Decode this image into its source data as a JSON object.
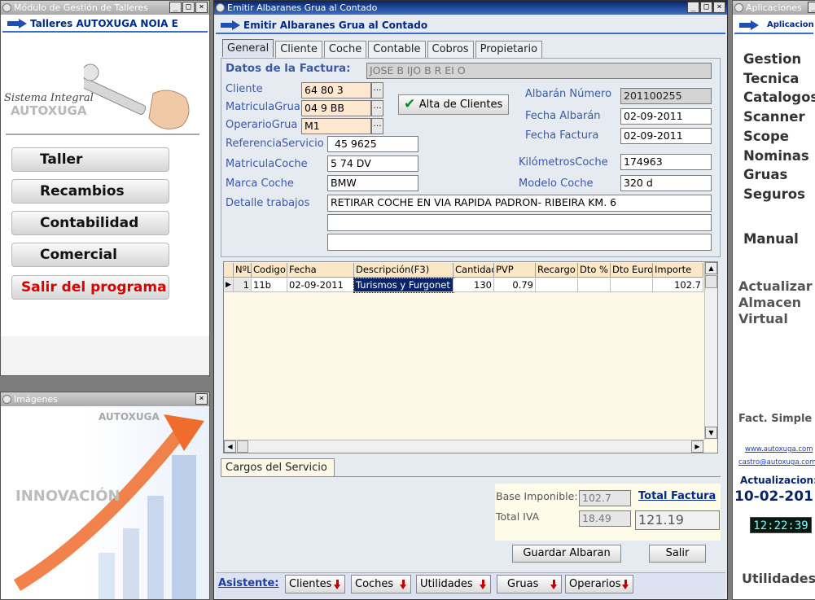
{
  "left_window": {
    "title": "Módulo de Gestión de Talleres",
    "header": "Talleres AUTOXUGA NOIA E",
    "logo_text": "Sistema Integral",
    "logo_brand": "AUTOXUGA",
    "menu": [
      "Taller",
      "Recambios",
      "Contabilidad",
      "Comercial",
      "Salir del programa"
    ]
  },
  "images_window": {
    "title": "Imágenes",
    "brand": "AUTOXUGA",
    "slogan": "INNOVACIÓN"
  },
  "main_window": {
    "title": "Emitir Albaranes Grua al Contado",
    "header": "Emitir Albaranes Grua al Contado",
    "tabs": [
      "General",
      "Cliente",
      "Coche",
      "Contable",
      "Cobros",
      "Propietario"
    ],
    "form": {
      "datos_label": "Datos de la Factura:",
      "datos_value": "JOSE   B  IJO    B  R  EI  O",
      "cliente_label": "Cliente",
      "cliente_value": "64  80  3",
      "matricula_grua_label": "MatriculaGrua",
      "matricula_grua_value": "04  9 BB",
      "operario_label": "OperarioGrua",
      "operario_value": "M1",
      "alta_button": "Alta de Clientes",
      "albaran_numero_label": "Albarán Número",
      "albaran_numero_value": "201100255",
      "fecha_albaran_label": "Fecha Albarán",
      "fecha_albaran_value": "02-09-2011",
      "fecha_factura_label": "Fecha Factura",
      "fecha_factura_value": "02-09-2011",
      "referencia_label": "ReferenciaServicio",
      "referencia_value": "45  9625",
      "matricula_coche_label": "MatriculaCoche",
      "matricula_coche_value": "5  74 DV",
      "km_label": "KilómetrosCoche",
      "km_value": "174963",
      "marca_label": "Marca Coche",
      "marca_value": "BMW",
      "modelo_label": "Modelo Coche",
      "modelo_value": "320 d",
      "detalle_label": "Detalle trabajos",
      "detalle_line1": "RETIRAR COCHE EN VIA RAPIDA PADRON- RIBEIRA KM. 6",
      "detalle_line2": "",
      "detalle_line3": ""
    },
    "grid": {
      "columns": [
        "NºL",
        "Codigo",
        "Fecha",
        "Descripción(F3)",
        "Cantidad",
        "PVP",
        "Recargo",
        "Dto %",
        "Dto Euro",
        "Importe"
      ],
      "rows": [
        [
          "1",
          "11b",
          "02-09-2011",
          "Turismos y Furgonet",
          "130",
          "0.79",
          "",
          "",
          "",
          "102.7"
        ]
      ]
    },
    "bottom_tab": "Cargos del Servicio",
    "totals": {
      "base_label": "Base Imponible:",
      "base_value": "102.7",
      "total_factura_label": "Total Factura",
      "iva_label": "Total IVA",
      "iva_value": "18.49",
      "total_value": "121.19"
    },
    "guardar_button": "Guardar Albaran",
    "salir_button": "Salir",
    "asistente_label": "Asistente:",
    "asistente_buttons": [
      "Clientes",
      "Coches",
      "Utilidades",
      "Gruas",
      "Operarios"
    ]
  },
  "right_window": {
    "title": "Aplicaciones",
    "header": "Aplicaciones",
    "menu": [
      "Gestion",
      "Tecnica",
      "Catalogos",
      "Scanner",
      "Scope",
      "Nominas",
      "Gruas",
      "Seguros"
    ],
    "manual": "Manual",
    "actualizar": [
      "Actualizar",
      "Almacen",
      "Virtual"
    ],
    "fact_simple": "Fact. Simple",
    "web": "www.autoxuga.com",
    "email": "castro@autoxuga.com",
    "actualizacion_label": "Actualizacion:",
    "actualizacion_date": "10-02-201",
    "clock": "12:22:39",
    "utilidades": "Utilidades"
  },
  "colors": {
    "title_active": "#0a246a",
    "label_blue": "#3a5aa8",
    "exit_red": "#d80000",
    "grid_header": "#fbe6c6",
    "grid_bg": "#fef9e7"
  }
}
